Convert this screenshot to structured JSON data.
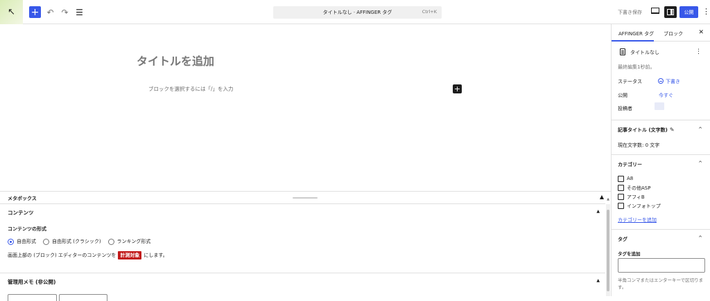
{
  "topbar": {
    "logo_icon": "↖",
    "undo_icon": "↶",
    "redo_icon": "↷",
    "list_icon": "☰",
    "add_icon": "+",
    "doc_title": "タイトルなし · AFFINGER タグ",
    "doc_kbd": "Ctrl+K",
    "draft_save": "下書き保存",
    "publish": "公開",
    "more_icon": "⋮"
  },
  "editor": {
    "title_placeholder": "タイトルを追加",
    "block_placeholder": "ブロックを選択するには「/」を入力",
    "inserter_icon": "+"
  },
  "metabox": {
    "header": "メタボックス",
    "toggle_icon": "▲",
    "contents_panel": {
      "title": "コンテンツ",
      "format_label": "コンテンツの形式",
      "options": [
        "自由形式",
        "自由形式 (クラシック)",
        "ランキング形式"
      ],
      "selected_index": 0,
      "note_before": "画面上部の (ブロック) エディターのコンテンツを",
      "badge": "計測対象",
      "note_after": "にします。"
    },
    "memo_panel": {
      "title": "管理用メモ (非公開)"
    }
  },
  "sidebar": {
    "tabs": [
      "AFFINGER タグ",
      "ブロック"
    ],
    "active_tab": 0,
    "close_icon": "✕",
    "post_name": "タイトルなし",
    "last_edited": "最終編集1秒前。",
    "status_label": "ステータス",
    "status_value": "下書き",
    "publish_label": "公開",
    "publish_value": "今すぐ",
    "author_label": "投稿者",
    "title_count_heading": "記事タイトル (文字数)",
    "title_count_value": "現在文字数: 0 文字",
    "categories_heading": "カテゴリー",
    "categories": [
      "A8",
      "その他ASP",
      "アフィB",
      "インフォトップ"
    ],
    "add_category": "カテゴリーを追加",
    "tags_heading": "タグ",
    "tag_add_label": "タグを追加",
    "tag_hint": "半角コンマまたはエンターキーで区切ります。",
    "caret_icon": "^",
    "pencil_icon": "✎"
  },
  "colors": {
    "accent": "#3858e9",
    "badge": "#c21a1a"
  }
}
